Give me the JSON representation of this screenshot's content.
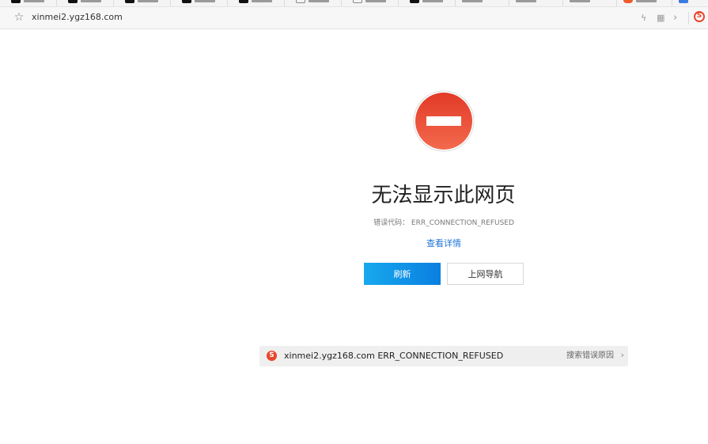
{
  "browser": {
    "url": "xinmei2.ygz168.com",
    "icons": {
      "star": "☆",
      "lightning": "ϟ",
      "qr": "▦",
      "chevron": "›"
    }
  },
  "error_page": {
    "title": "无法显示此网页",
    "error_code": "错误代码： ERR_CONNECTION_REFUSED",
    "details_link": "查看详情",
    "refresh_label": "刷新",
    "nav_label": "上网导航"
  },
  "search_suggestion": {
    "query": "xinmei2.ygz168.com ERR_CONNECTION_REFUSED",
    "reason_label": "搜索错误原因",
    "chevron": "›"
  },
  "colors": {
    "stop_red": "#e5432d",
    "link_blue": "#1f74d6",
    "button_blue": "#0a7fe0"
  }
}
